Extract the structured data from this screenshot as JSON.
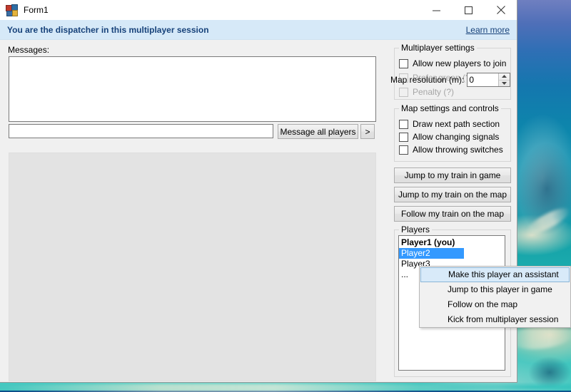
{
  "window": {
    "title": "Form1",
    "icon": "windows-forms-icon",
    "buttons": {
      "minimize": "minimize-icon",
      "maximize": "maximize-icon",
      "close": "close-icon"
    }
  },
  "banner": {
    "text": "You are the dispatcher in this multiplayer session",
    "link": "Learn more",
    "background": "#d6e9f8",
    "text_color": "#17427a"
  },
  "messages": {
    "label": "Messages:",
    "log_value": "",
    "input_value": "",
    "input_placeholder": "",
    "send_all_label": "Message all players",
    "send_arrow_label": ">"
  },
  "multiplayer_settings": {
    "title": "Multiplayer settings",
    "checkboxes": [
      {
        "label": "Allow new players to join",
        "checked": false,
        "disabled": false
      },
      {
        "label": "Prefer green (?)",
        "checked": false,
        "disabled": true
      },
      {
        "label": "Penalty (?)",
        "checked": false,
        "disabled": true
      }
    ]
  },
  "map_settings": {
    "title": "Map settings and controls",
    "checkboxes": [
      {
        "label": "Draw next path section",
        "checked": false,
        "disabled": false
      },
      {
        "label": "Allow changing signals",
        "checked": false,
        "disabled": false
      },
      {
        "label": "Allow throwing switches",
        "checked": false,
        "disabled": false
      }
    ],
    "resolution_label": "Map resolution (m):",
    "resolution_value": "0",
    "spinner_up": "▲",
    "spinner_down": "▼"
  },
  "actions": {
    "jump_train_game": "Jump to my train in game",
    "jump_train_map": "Jump to my train on the map",
    "follow_train_map": "Follow my train on the map"
  },
  "players": {
    "title": "Players",
    "items": [
      {
        "label": "Player1 (you)",
        "self": true,
        "selected": false
      },
      {
        "label": "Player2",
        "self": false,
        "selected": true
      },
      {
        "label": "Player3",
        "self": false,
        "selected": false
      },
      {
        "label": "...",
        "self": false,
        "selected": false
      }
    ],
    "selection_color": "#3399ff"
  },
  "context_menu": {
    "items": [
      {
        "label": "Make this player an assistant",
        "highlighted": true
      },
      {
        "label": "Jump to this player in game",
        "highlighted": false
      },
      {
        "label": "Follow on the map",
        "highlighted": false
      },
      {
        "label": "Kick from multiplayer session",
        "highlighted": false
      }
    ],
    "highlight_color": "#d8eaf9"
  }
}
